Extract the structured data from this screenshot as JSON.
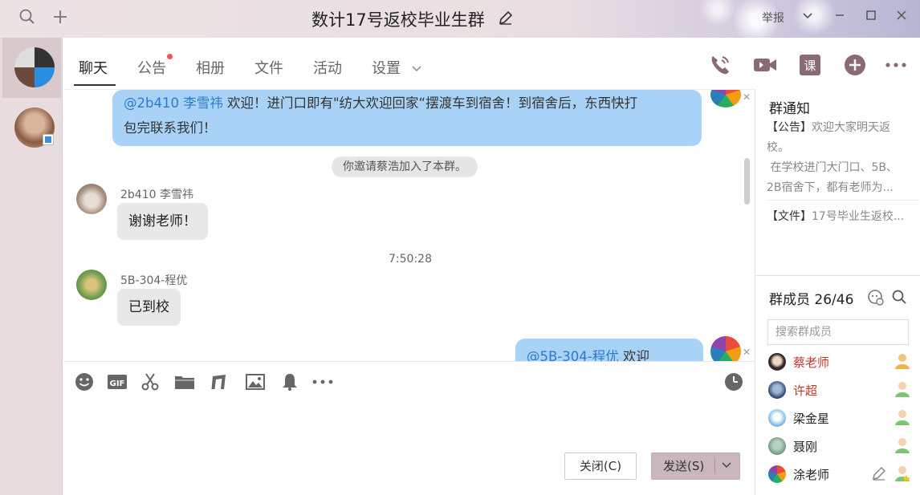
{
  "window": {
    "title": "数计17号返校毕业生群",
    "report_label": "举报"
  },
  "tabs": [
    {
      "label": "聊天"
    },
    {
      "label": "公告"
    },
    {
      "label": "相册"
    },
    {
      "label": "文件"
    },
    {
      "label": "活动"
    },
    {
      "label": "设置"
    }
  ],
  "messages": {
    "top_bubble": {
      "mention": "@2b410 李雪祎",
      "line1_rest": " 欢迎！进门口即有\"纺大欢迎回家“摆渡车到宿舍！到宿舍后，东西快打",
      "line2": "包完联系我们！"
    },
    "system_note": "你邀请蔡浩加入了本群。",
    "msg1": {
      "sender": "2b410 李雪祎",
      "text": "谢谢老师！"
    },
    "time": "7:50:28",
    "msg2": {
      "sender": "5B-304-程优",
      "text": "已到校"
    },
    "bottom_bubble": {
      "mention": "@5B-304-程优",
      "rest": " 欢迎"
    }
  },
  "input": {
    "close_label": "关闭(C)",
    "send_label": "发送(S)"
  },
  "side": {
    "notice_title": "群通知",
    "notice_tag": "【公告】",
    "notice_line1": "欢迎大家明天返",
    "notice_line2": "校。",
    "notice_line3": " 在学校进门大门口、5B、",
    "notice_line4": "2B宿舍下，都有老师为...",
    "file_tag": "【文件】",
    "file_text": "17号毕业生返校...",
    "members_title": "群成员 26/46",
    "search_placeholder": "搜索群成员",
    "members": [
      {
        "name": "蔡老师",
        "color": "#c0392b"
      },
      {
        "name": "许超",
        "color": "#c0392b"
      },
      {
        "name": "梁金星",
        "color": "#222222"
      },
      {
        "name": "聂刚",
        "color": "#222222"
      },
      {
        "name": "涂老师",
        "color": "#222222"
      }
    ]
  },
  "colors": {
    "accent": "#8a6a74",
    "bubble_blue": "#a8d3f7",
    "send_button": "#c9b7bd",
    "notify_dot": "#ee5555"
  }
}
